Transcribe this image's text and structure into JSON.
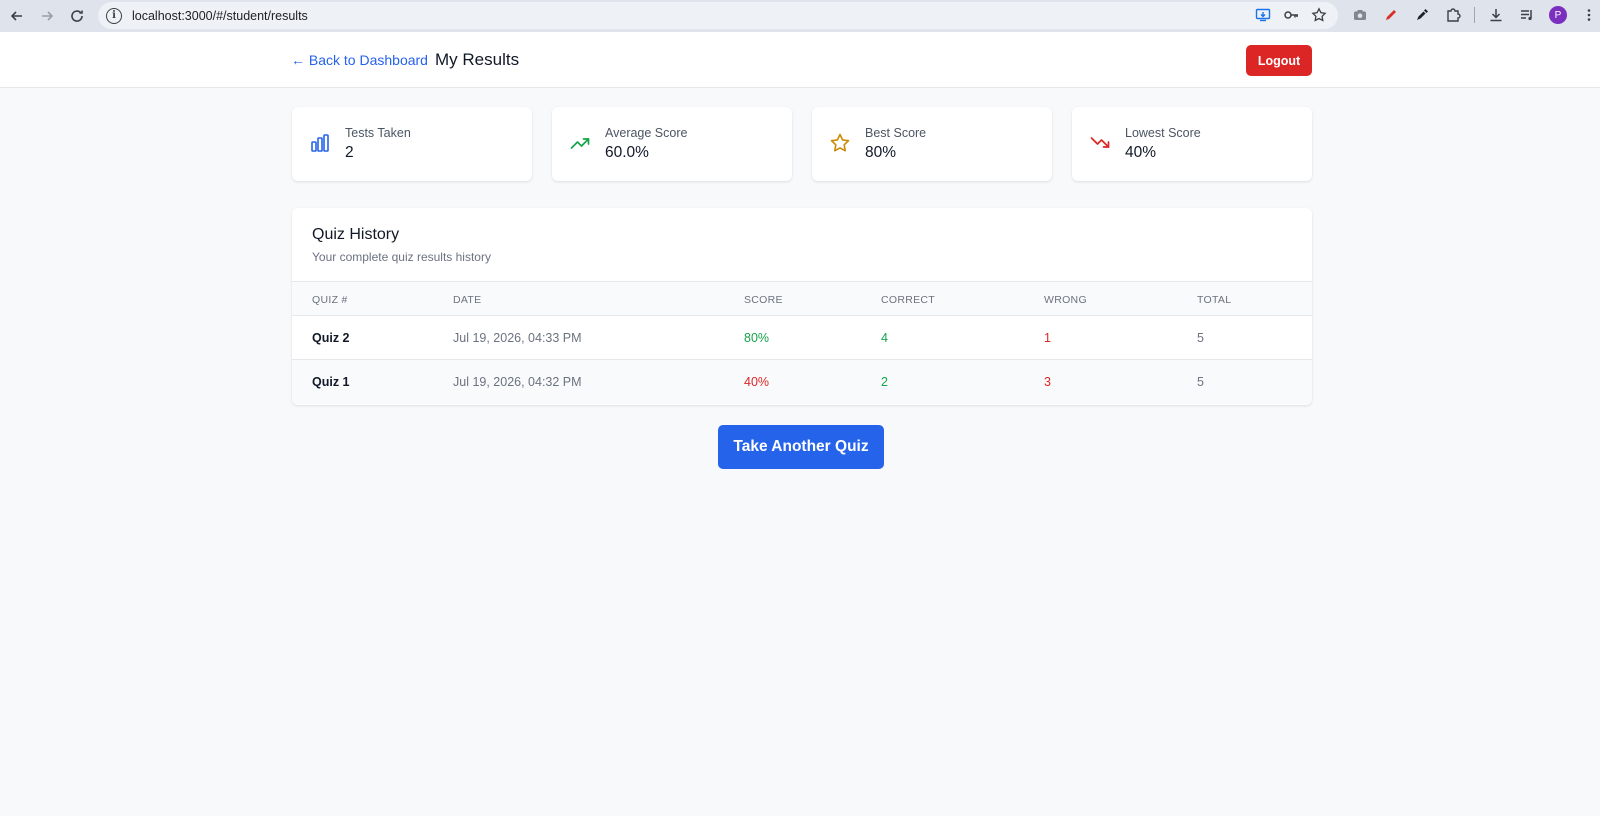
{
  "browser": {
    "url": "localhost:3000/#/student/results",
    "profile_initial": "P"
  },
  "header": {
    "back_label": "← Back to Dashboard",
    "title": "My Results",
    "logout_label": "Logout"
  },
  "stats": [
    {
      "label": "Tests Taken",
      "value": "2",
      "icon": "bar-chart-icon",
      "color": "#2563eb"
    },
    {
      "label": "Average Score",
      "value": "60.0%",
      "icon": "trending-up-icon",
      "color": "#16a34a"
    },
    {
      "label": "Best Score",
      "value": "80%",
      "icon": "star-icon",
      "color": "#ca8a04"
    },
    {
      "label": "Lowest Score",
      "value": "40%",
      "icon": "trending-down-icon",
      "color": "#dc2626"
    }
  ],
  "history": {
    "title": "Quiz History",
    "subtitle": "Your complete quiz results history",
    "columns": [
      "QUIZ #",
      "DATE",
      "SCORE",
      "CORRECT",
      "WRONG",
      "TOTAL"
    ],
    "rows": [
      {
        "quiz": "Quiz 2",
        "date": "Jul 19, 2026, 04:33 PM",
        "score": "80%",
        "correct": "4",
        "wrong": "1",
        "total": "5"
      },
      {
        "quiz": "Quiz 1",
        "date": "Jul 19, 2026, 04:32 PM",
        "score": "40%",
        "correct": "2",
        "wrong": "3",
        "total": "5"
      }
    ]
  },
  "actions": {
    "take_another_label": "Take Another Quiz"
  },
  "colors": {
    "primary": "#2563eb",
    "danger": "#dc2626",
    "success": "#16a34a"
  }
}
